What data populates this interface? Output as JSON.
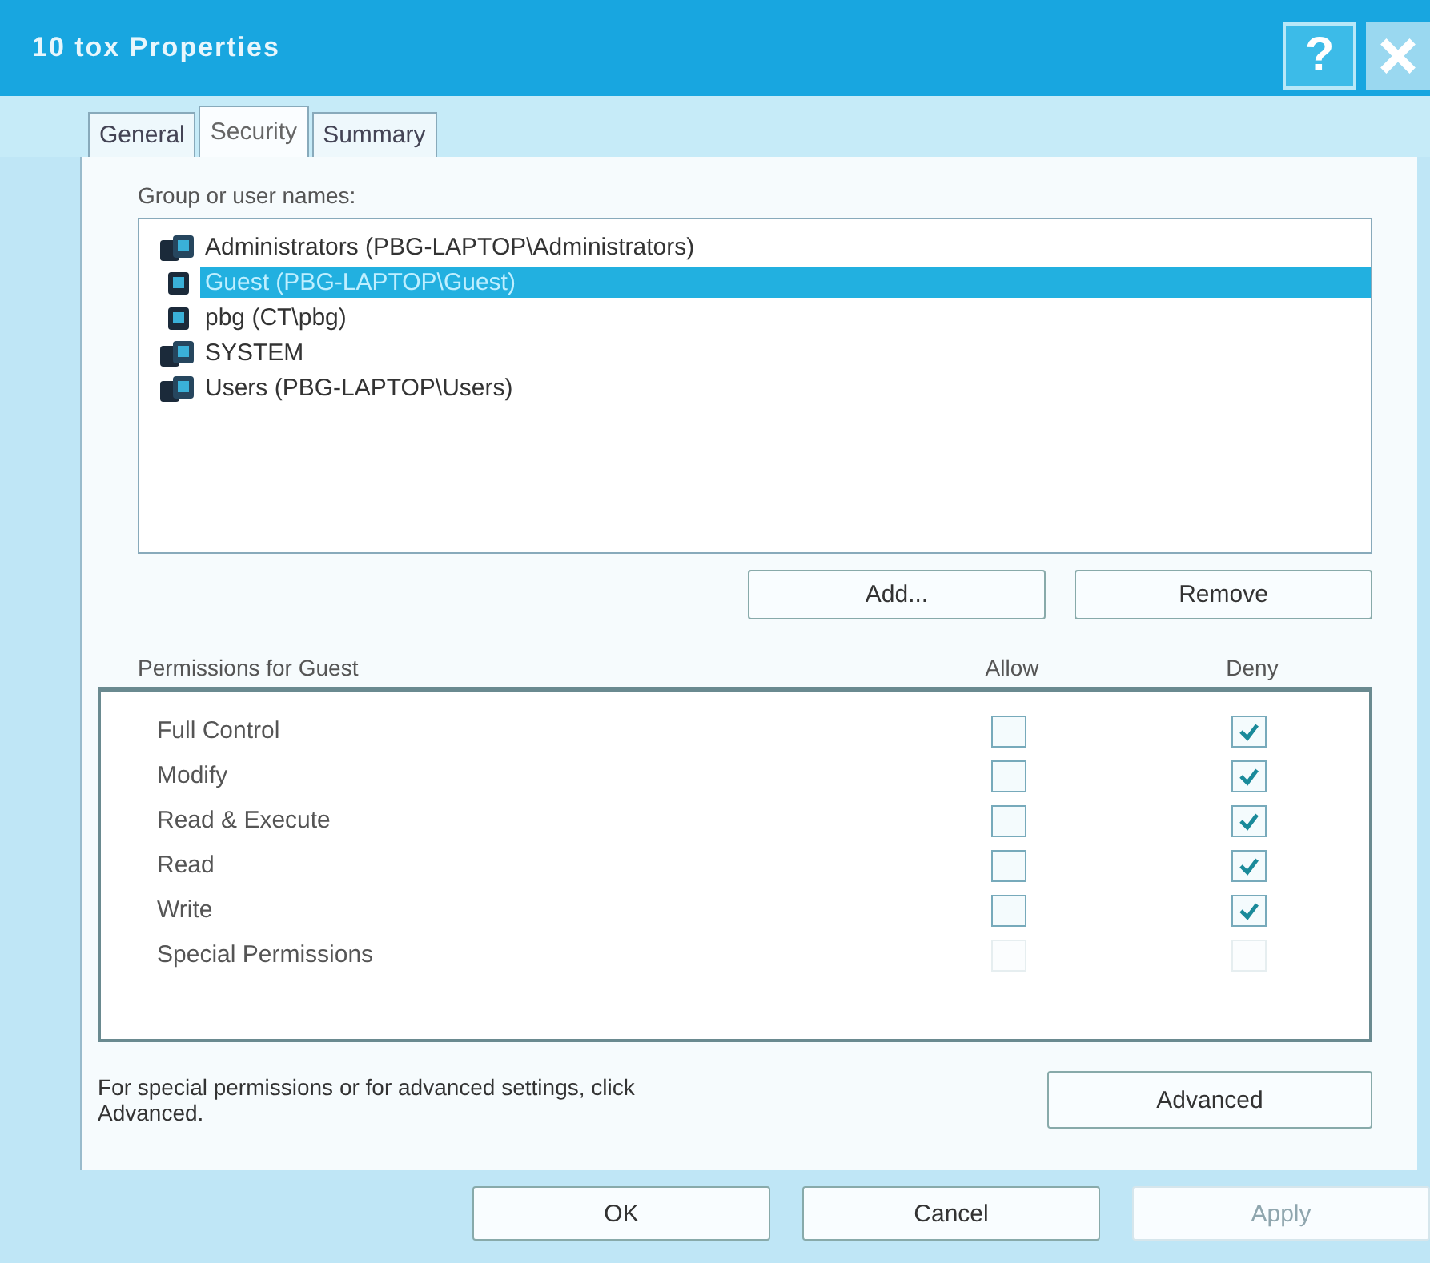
{
  "window": {
    "title": "10 tox Properties",
    "help_button": "?"
  },
  "tabs": [
    {
      "label": "General",
      "selected": false
    },
    {
      "label": "Security",
      "selected": true
    },
    {
      "label": "Summary",
      "selected": false
    }
  ],
  "group_label": "Group or user names:",
  "users": [
    {
      "name": "Administrators (PBG-LAPTOP\\Administrators)",
      "kind": "group",
      "selected": false
    },
    {
      "name": "Guest (PBG-LAPTOP\\Guest)",
      "kind": "user",
      "selected": true
    },
    {
      "name": "pbg (CT\\pbg)",
      "kind": "user",
      "selected": false
    },
    {
      "name": "SYSTEM",
      "kind": "group",
      "selected": false
    },
    {
      "name": "Users (PBG-LAPTOP\\Users)",
      "kind": "group",
      "selected": false
    }
  ],
  "user_buttons": [
    "Add...",
    "Remove"
  ],
  "permissions": {
    "label": "Permissions for Guest",
    "allow_header": "Allow",
    "deny_header": "Deny",
    "rows": [
      {
        "name": "Full Control",
        "allow": false,
        "deny": true,
        "disabled": false
      },
      {
        "name": "Modify",
        "allow": false,
        "deny": true,
        "disabled": false
      },
      {
        "name": "Read & Execute",
        "allow": false,
        "deny": true,
        "disabled": false
      },
      {
        "name": "Read",
        "allow": false,
        "deny": true,
        "disabled": false
      },
      {
        "name": "Write",
        "allow": false,
        "deny": true,
        "disabled": false
      },
      {
        "name": "Special Permissions",
        "allow": false,
        "deny": false,
        "disabled": true
      }
    ]
  },
  "advanced_note": "For special permissions or for advanced settings, click Advanced.",
  "advanced_button": "Advanced",
  "buttons": [
    {
      "label": "OK",
      "disabled": false
    },
    {
      "label": "Cancel",
      "disabled": false
    },
    {
      "label": "Apply",
      "disabled": true
    }
  ]
}
